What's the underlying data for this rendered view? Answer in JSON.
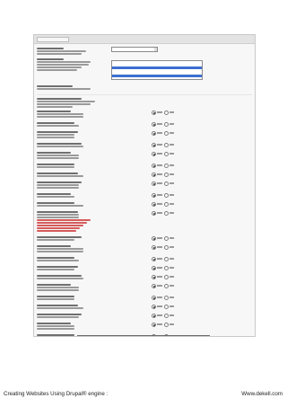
{
  "footer": {
    "left_text": "Creating Websites Using Drupal® engine :",
    "right_text": "Www.dekell.com"
  },
  "form": {
    "select_values": [
      "Default",
      "Default",
      "0",
      "0"
    ],
    "listbox_options": [
      "",
      "",
      "Album",
      "",
      "",
      "Advanced",
      "Admin"
    ],
    "radio_labels": [
      "Yes",
      "No"
    ]
  },
  "colors": {
    "page_background": "#ffffff",
    "panel_background": "#f7f7f7",
    "selection_highlight": "#3e6fd1",
    "warning_text": "#d55b5b"
  }
}
